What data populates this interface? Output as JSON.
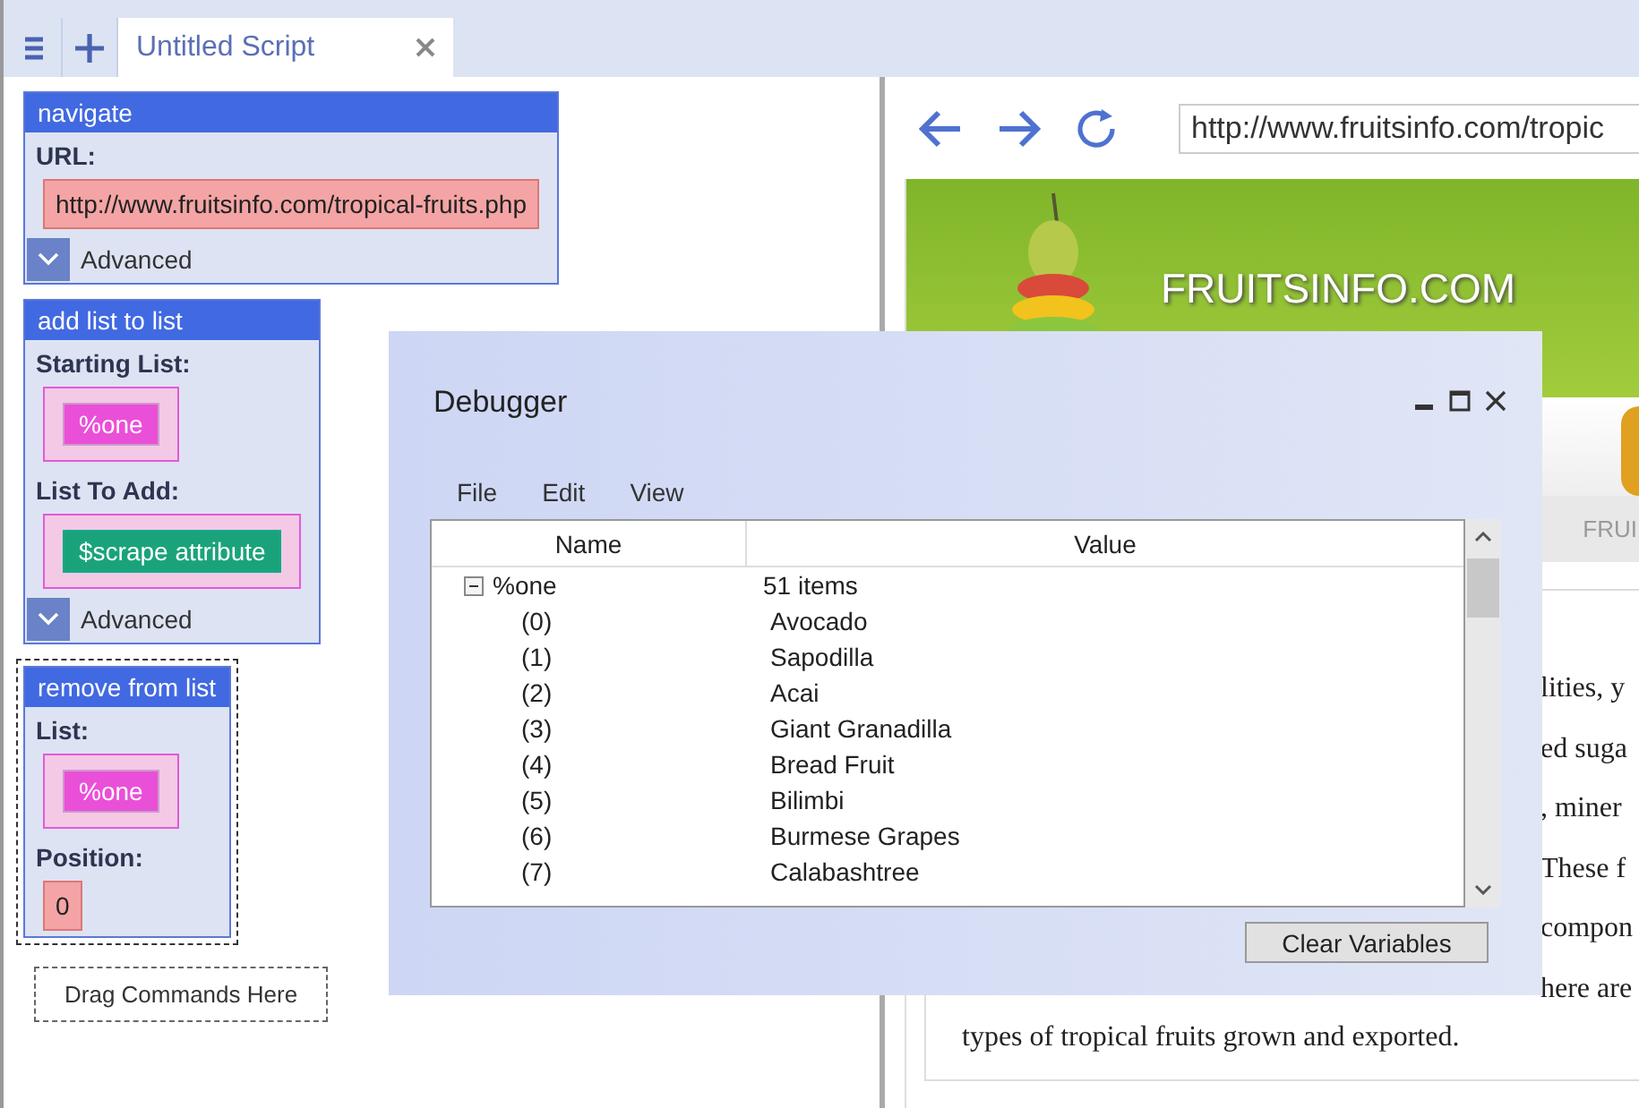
{
  "script_tab": {
    "title": "Untitled Script"
  },
  "blocks": [
    {
      "title": "navigate",
      "selected": false,
      "fields": [
        {
          "label": "URL:",
          "kind": "text",
          "value": "http://www.fruitsinfo.com/tropical-fruits.php"
        }
      ],
      "advanced": "Advanced"
    },
    {
      "title": "add list to list",
      "selected": false,
      "fields": [
        {
          "label": "Starting List:",
          "kind": "variable",
          "value": "%one"
        },
        {
          "label": "List To Add:",
          "kind": "command",
          "value": "$scrape attribute"
        }
      ],
      "advanced": "Advanced"
    },
    {
      "title": "remove from list",
      "selected": true,
      "fields": [
        {
          "label": "List:",
          "kind": "variable",
          "value": "%one"
        },
        {
          "label": "Position:",
          "kind": "text",
          "value": "0"
        }
      ]
    }
  ],
  "drop_zone": "Drag Commands Here",
  "browser": {
    "url": "http://www.fruitsinfo.com/tropic",
    "site_title": "FRUITSINFO.COM",
    "nav_tab": "FRUI",
    "body_lines": [
      {
        "kind": "fragment",
        "text": "lities, y"
      },
      {
        "kind": "fragment",
        "text": "ed suga"
      },
      {
        "kind": "fragment",
        "text": ", miner"
      },
      {
        "kind": "fragment",
        "text": "These f"
      },
      {
        "kind": "fragment",
        "text": "compon"
      },
      {
        "kind": "fragment",
        "text": "here are"
      },
      {
        "kind": "line",
        "text": "types of tropical fruits grown and exported."
      }
    ]
  },
  "debugger": {
    "title": "Debugger",
    "menu": [
      "File",
      "Edit",
      "View"
    ],
    "columns": [
      "Name",
      "Value"
    ],
    "rows": [
      {
        "name": "%one",
        "value": "51 items",
        "expanded": true,
        "children": [
          {
            "name": "(0)",
            "value": "Avocado"
          },
          {
            "name": "(1)",
            "value": "Sapodilla"
          },
          {
            "name": "(2)",
            "value": "Acai"
          },
          {
            "name": "(3)",
            "value": "Giant Granadilla"
          },
          {
            "name": "(4)",
            "value": "Bread Fruit"
          },
          {
            "name": "(5)",
            "value": "Bilimbi"
          },
          {
            "name": "(6)",
            "value": "Burmese Grapes"
          },
          {
            "name": "(7)",
            "value": "Calabashtree"
          }
        ]
      }
    ],
    "button": "Clear Variables"
  }
}
